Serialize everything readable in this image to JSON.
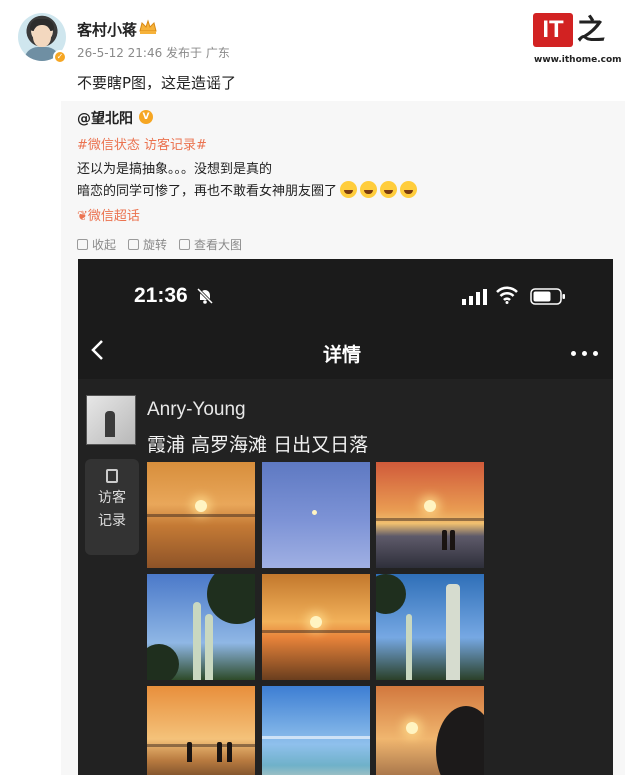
{
  "header": {
    "username": "客村小蒋",
    "meta": "26-5-12 21:46 发布于 广东",
    "post_text": "不要瞎P图，这是造谣了",
    "logo_text": "IT之家",
    "logo_url": "www.ithome.com"
  },
  "repost": {
    "user": "@望北阳",
    "tags": "#微信状态 访客记录#",
    "line1": "还以为是搞抽象。。。没想到是真的",
    "line2": "暗恋的同学可惨了，再也不敢看女神朋友圈了",
    "super_topic": "微信超话",
    "actions": {
      "collect": "收起",
      "rotate": "旋转",
      "view_large": "查看大图"
    }
  },
  "phone": {
    "time": "21:36",
    "title": "详情",
    "name": "Anry-Young",
    "caption": "霞浦 高罗海滩 日出又日落",
    "visit_line1": "访客",
    "visit_line2": "记录"
  },
  "icons": [
    "crown-icon",
    "verified-icon",
    "bell-muted-icon",
    "signal-icon",
    "wifi-icon",
    "battery-icon",
    "back-icon",
    "more-icon",
    "fold-icon"
  ],
  "colors": {
    "accent": "#eb7350",
    "verified": "#f6a623",
    "logo_red": "#d22222",
    "phone_bg": "#1b1b1b"
  }
}
